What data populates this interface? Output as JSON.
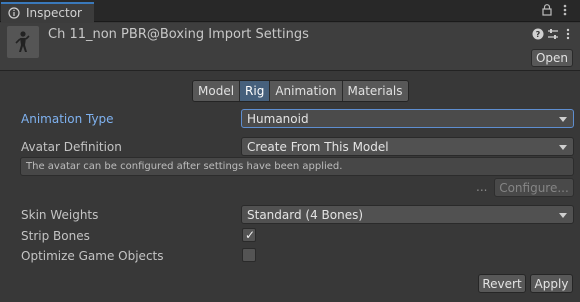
{
  "window": {
    "tab_title": "Inspector",
    "tab_icon": "info-icon",
    "toolbar_icons": [
      "lock-icon",
      "kebab-menu-icon"
    ]
  },
  "header": {
    "asset_icon": "humanoid-model-icon",
    "title": "Ch 11_non PBR@Boxing Import Settings",
    "icons": [
      "help-icon",
      "preset-icon",
      "kebab-menu-icon"
    ],
    "open_label": "Open"
  },
  "tabs": [
    {
      "label": "Model",
      "active": false
    },
    {
      "label": "Rig",
      "active": true
    },
    {
      "label": "Animation",
      "active": false
    },
    {
      "label": "Materials",
      "active": false
    }
  ],
  "rig": {
    "animation_type": {
      "label": "Animation Type",
      "value": "Humanoid"
    },
    "avatar_definition": {
      "label": "Avatar Definition",
      "value": "Create From This Model"
    },
    "help_text": "The avatar can be configured after settings have been applied.",
    "ellipsis": "...",
    "configure_label": "Configure...",
    "skin_weights": {
      "label": "Skin Weights",
      "value": "Standard (4 Bones)"
    },
    "strip_bones": {
      "label": "Strip Bones",
      "checked": true,
      "mark": "✓"
    },
    "optimize_game_objects": {
      "label": "Optimize Game Objects",
      "checked": false
    }
  },
  "footer": {
    "revert_label": "Revert",
    "apply_label": "Apply"
  },
  "colors": {
    "accent": "#3a79bb",
    "active_tab": "#46607c",
    "focus_border": "#5e8ed0",
    "highlight_label": "#7fb2f0"
  }
}
